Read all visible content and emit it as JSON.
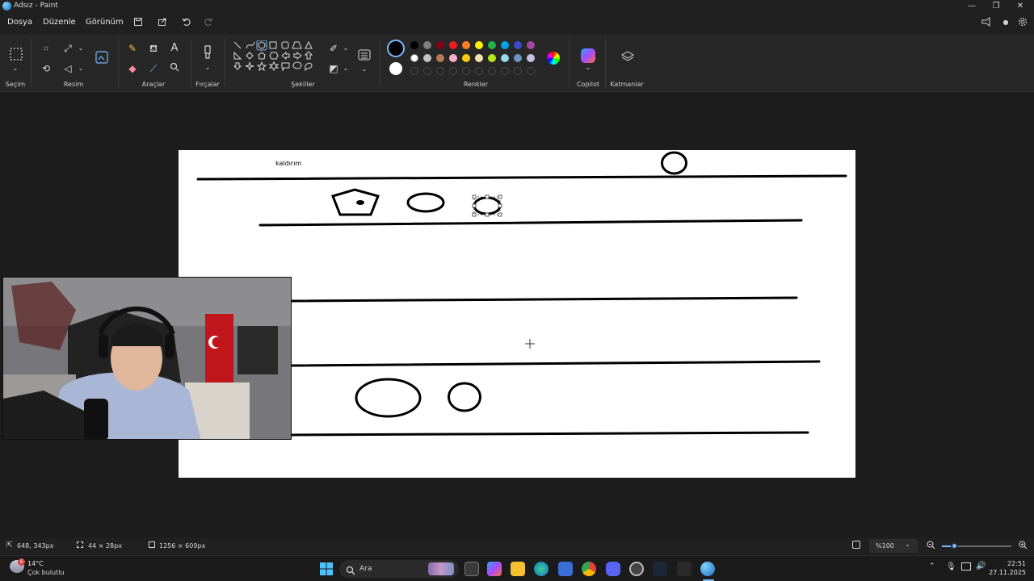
{
  "window": {
    "title": "Adsız - Paint",
    "minimize": "—",
    "maximize": "❐",
    "close": "✕"
  },
  "menu": {
    "file": "Dosya",
    "edit": "Düzenle",
    "view": "Görünüm"
  },
  "ribbon": {
    "groups": {
      "selection": "Seçim",
      "image": "Resim",
      "tools": "Araçlar",
      "brushes": "Fırçalar",
      "shapes": "Şekiller",
      "colors": "Renkler",
      "copilot": "Copilot",
      "layers": "Katmanlar"
    },
    "colors": {
      "row1": [
        "#000000",
        "#7f7f7f",
        "#880015",
        "#ed1c24",
        "#ff7f27",
        "#fff200",
        "#22b14c",
        "#00a2e8",
        "#3f48cc",
        "#a349a4"
      ],
      "row2": [
        "#ffffff",
        "#c3c3c3",
        "#b97a57",
        "#ffaec9",
        "#ffc90e",
        "#efe4b0",
        "#b5e61d",
        "#99d9ea",
        "#7092be",
        "#c8bfe7"
      ],
      "primary": "#000000",
      "secondary": "#ffffff"
    }
  },
  "canvas": {
    "label_text": "kaldırım"
  },
  "status": {
    "cursor_pos": "648, 343px",
    "selection_size": "44 × 28px",
    "canvas_size": "1256 × 609px",
    "zoom": "%100"
  },
  "taskbar": {
    "weather_temp": "14°C",
    "weather_desc": "Çok bulutlu",
    "weather_badge": "6",
    "search_placeholder": "Ara",
    "time": "22:51",
    "date": "27.11.2025"
  }
}
